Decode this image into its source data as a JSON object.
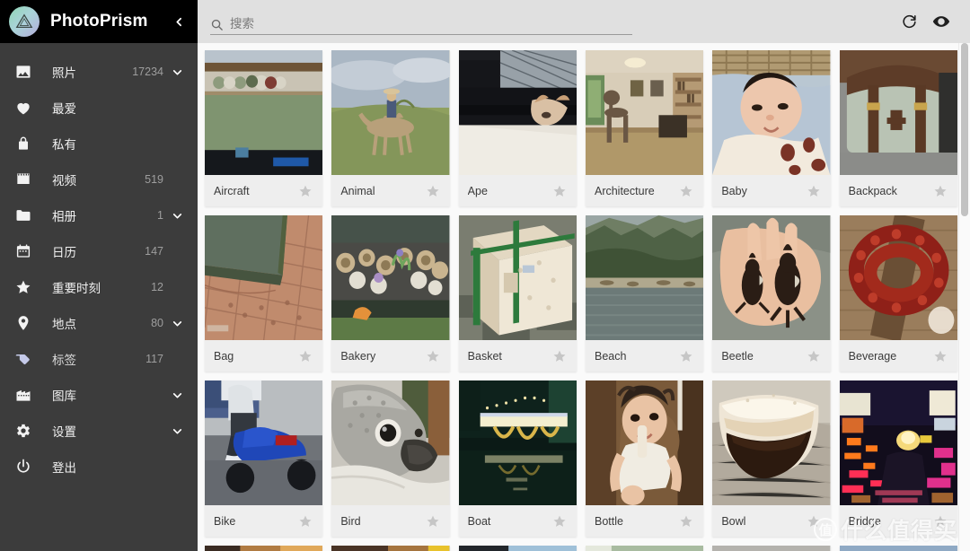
{
  "app": {
    "brand": "PhotoPrism",
    "logo_icon": "photoprism-triangle-logo",
    "collapse_icon": "chevron-left-icon",
    "accent_color": "#c5cae9",
    "sidebar_bg": "#3c3c3c",
    "header_bg": "#000000"
  },
  "toolbar": {
    "search_placeholder": "搜索",
    "search_value": "",
    "search_icon": "search-icon",
    "reload_icon": "refresh-icon",
    "reload_label": "",
    "visibility_icon": "eye-icon",
    "visibility_label": ""
  },
  "sidebar": {
    "items": [
      {
        "label": "照片",
        "count": "17234",
        "icon": "image-icon",
        "expandable": true,
        "active": false
      },
      {
        "label": "最爱",
        "count": "",
        "icon": "heart-icon",
        "expandable": false,
        "active": false
      },
      {
        "label": "私有",
        "count": "",
        "icon": "lock-icon",
        "expandable": false,
        "active": false
      },
      {
        "label": "视频",
        "count": "519",
        "icon": "film-icon",
        "expandable": false,
        "active": false
      },
      {
        "label": "相册",
        "count": "1",
        "icon": "folder-icon",
        "expandable": true,
        "active": false
      },
      {
        "label": "日历",
        "count": "147",
        "icon": "calendar-icon",
        "expandable": false,
        "active": false
      },
      {
        "label": "重要时刻",
        "count": "12",
        "icon": "star-icon",
        "expandable": false,
        "active": false
      },
      {
        "label": "地点",
        "count": "80",
        "icon": "place-pin-icon",
        "expandable": true,
        "active": false
      },
      {
        "label": "标签",
        "count": "117",
        "icon": "label-tag-icon",
        "expandable": false,
        "active": true
      },
      {
        "label": "图库",
        "count": "",
        "icon": "library-icon",
        "expandable": true,
        "active": false
      },
      {
        "label": "设置",
        "count": "",
        "icon": "gear-icon",
        "expandable": true,
        "active": false
      },
      {
        "label": "登出",
        "count": "",
        "icon": "power-icon",
        "expandable": false,
        "active": false
      }
    ]
  },
  "grid": {
    "star_icon": "star-outline-icon",
    "cards": [
      {
        "title": "Aircraft",
        "favorite": false,
        "thumb": "shelf-of-pottery-beside-green-field"
      },
      {
        "title": "Animal",
        "favorite": false,
        "thumb": "person-riding-camel-on-grassland"
      },
      {
        "title": "Ape",
        "favorite": false,
        "thumb": "cat-peeking-through-dark-fence"
      },
      {
        "title": "Architecture",
        "favorite": false,
        "thumb": "interior-dining-room-with-bookshelves"
      },
      {
        "title": "Baby",
        "favorite": false,
        "thumb": "baby-lying-on-blue-blanket"
      },
      {
        "title": "Backpack",
        "favorite": false,
        "thumb": "canvas-backpack-with-leather-straps"
      },
      {
        "title": "Bag",
        "favorite": false,
        "thumb": "green-bag-corner-on-brick-floor"
      },
      {
        "title": "Bakery",
        "favorite": false,
        "thumb": "potted-succulents-on-market-table"
      },
      {
        "title": "Basket",
        "favorite": false,
        "thumb": "cardboard-box-with-green-strap"
      },
      {
        "title": "Beach",
        "favorite": false,
        "thumb": "river-beside-forested-cliff"
      },
      {
        "title": "Beetle",
        "favorite": false,
        "thumb": "two-beetles-held-in-hand"
      },
      {
        "title": "Beverage",
        "favorite": false,
        "thumb": "red-bead-necklace-on-wood"
      },
      {
        "title": "Bike",
        "favorite": false,
        "thumb": "person-on-blue-scooter"
      },
      {
        "title": "Bird",
        "favorite": false,
        "thumb": "grey-parrot-close-up"
      },
      {
        "title": "Boat",
        "favorite": false,
        "thumb": "illuminated-bridge-over-dark-water"
      },
      {
        "title": "Bottle",
        "favorite": false,
        "thumb": "toddler-eating-on-brown-couch"
      },
      {
        "title": "Bowl",
        "favorite": false,
        "thumb": "bowl-of-dark-coffee-on-table"
      },
      {
        "title": "Bridge",
        "favorite": false,
        "thumb": "night-street-with-neon-lights"
      },
      {
        "title": "",
        "favorite": false,
        "thumb": "partial-row-warm-sunset"
      },
      {
        "title": "",
        "favorite": false,
        "thumb": "partial-row-warm-yellow"
      },
      {
        "title": "",
        "favorite": false,
        "thumb": "partial-row-dark-sky"
      },
      {
        "title": "",
        "favorite": false,
        "thumb": "partial-row-pale-green"
      },
      {
        "title": "",
        "favorite": false,
        "thumb": "partial-row-grey"
      },
      {
        "title": "",
        "favorite": false,
        "thumb": "partial-row-blue"
      }
    ]
  },
  "watermark": {
    "badge": "值",
    "text": "什么值得买"
  }
}
